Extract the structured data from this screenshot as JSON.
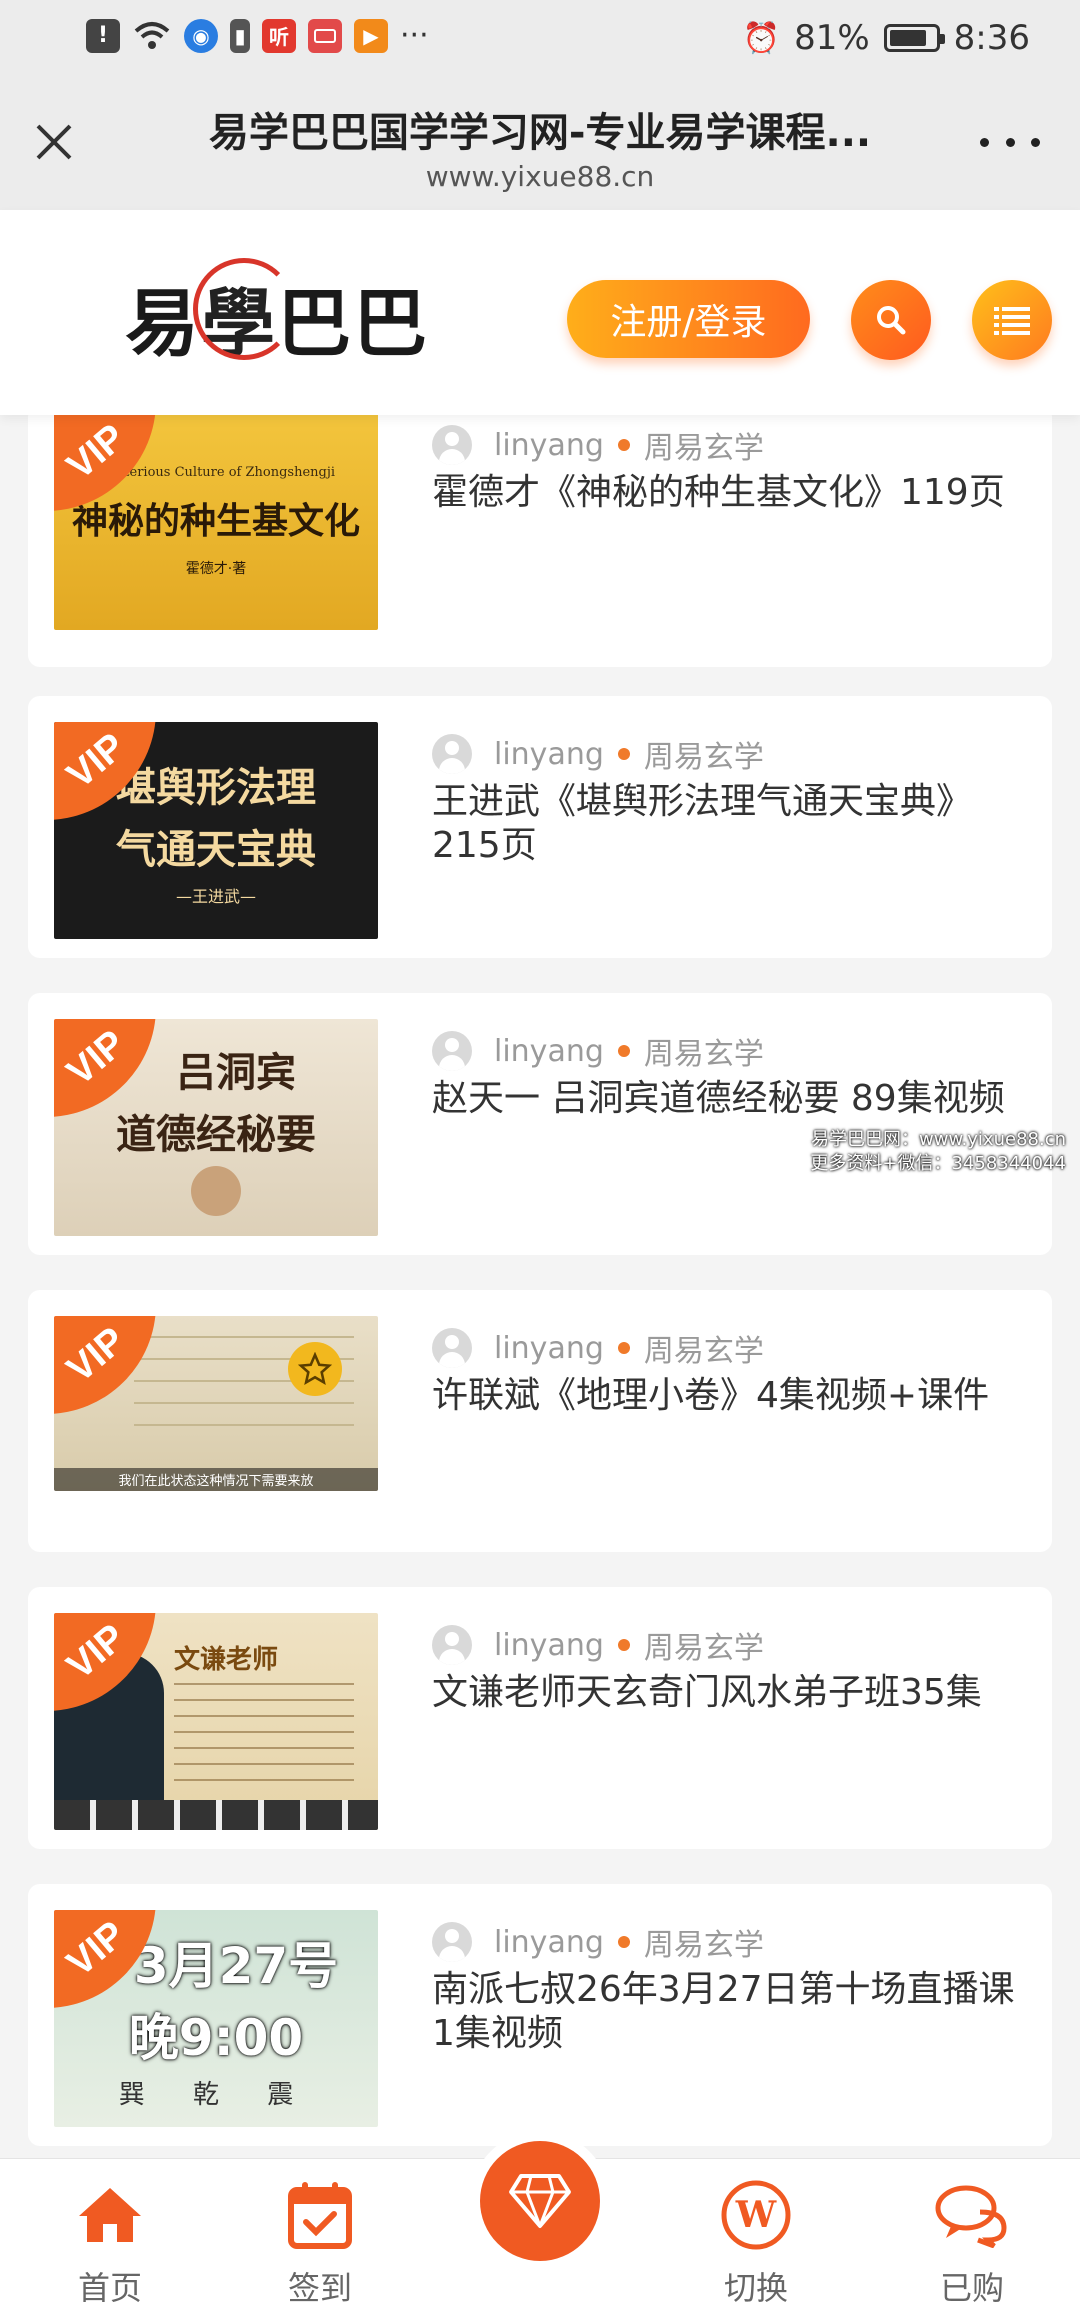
{
  "status_bar": {
    "alarm": "⏰",
    "battery": "81%",
    "battery_level": 0.81,
    "time": "8:36",
    "more": "···",
    "app_icons": [
      "!",
      "◉",
      "▮",
      "听",
      "▶"
    ]
  },
  "browser": {
    "title": "易学巴巴国学学习网-专业易学课程...",
    "url": "www.yixue88.cn",
    "close_icon": "close-icon",
    "more_icon": "more-icon"
  },
  "header": {
    "logo_text_1": "易",
    "logo_text_2": "學",
    "logo_text_3": "巴巴",
    "login_label": "注册/登录",
    "search_icon": "search-icon",
    "menu_icon": "list-icon"
  },
  "posts": [
    {
      "author": "linyang",
      "category": "周易玄学",
      "title": "霍德才《神秘的种生基文化》119页",
      "thumb_line1": "Mysterious Culture of Zhongshengji",
      "thumb_line2": "神秘的种生基文化",
      "thumb_line3": "霍德才·著",
      "badge": "VIP"
    },
    {
      "author": "linyang",
      "category": "周易玄学",
      "title": "王进武《堪舆形法理气通天宝典》215页",
      "thumb_line1": "堪舆形法理",
      "thumb_line2": "气通天宝典",
      "thumb_line3": "—王进武—",
      "badge": "VIP"
    },
    {
      "author": "linyang",
      "category": "周易玄学",
      "title": "赵天一 吕洞宾道德经秘要 89集视频",
      "thumb_line1": "吕洞宾",
      "thumb_line2": "道德经秘要",
      "thumb_line3": "",
      "badge": "VIP"
    },
    {
      "author": "linyang",
      "category": "周易玄学",
      "title": "许联斌《地理小卷》4集视频+课件",
      "thumb_line1": "",
      "thumb_line2": "",
      "thumb_line3": "我们在此状态这种情况下需要来放",
      "badge": "VIP"
    },
    {
      "author": "linyang",
      "category": "周易玄学",
      "title": "文谦老师天玄奇门风水弟子班35集",
      "thumb_line1": "文谦老师",
      "thumb_line2": "",
      "thumb_line3": "",
      "badge": "VIP"
    },
    {
      "author": "linyang",
      "category": "周易玄学",
      "title": "南派七叔26年3月27日第十场直播课1集视频",
      "thumb_line1": "3月27号",
      "thumb_line2": "晚9:00",
      "thumb_line3": "巽 乾 震",
      "badge": "VIP"
    }
  ],
  "watermark": {
    "line1": "易学巴巴网：www.yixue88.cn",
    "line2": "更多资料+微信：3458344044"
  },
  "bottom_nav": {
    "home": "首页",
    "checkin": "签到",
    "switch": "切换",
    "purchased": "已购"
  },
  "colors": {
    "accent": "#f26a23",
    "gradient_start": "#ffae1a",
    "gradient_end": "#ff6a1f"
  }
}
